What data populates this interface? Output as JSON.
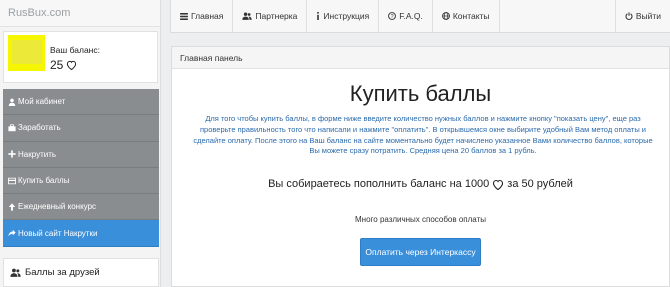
{
  "brand": "RusBux.com",
  "user": {
    "balance_label": "Ваш баланс:",
    "balance_value": "25"
  },
  "menu": [
    {
      "label": "Мой кабинет",
      "icon": "user-icon"
    },
    {
      "label": "Заработать",
      "icon": "briefcase-icon"
    },
    {
      "label": "Накрутить",
      "icon": "plus-icon"
    },
    {
      "label": "Купить баллы",
      "icon": "card-icon"
    },
    {
      "label": "Ежедневный конкурс",
      "icon": "up-arrow-icon"
    },
    {
      "label": "Новый сайт Накрутки",
      "icon": "share-icon",
      "active": true
    }
  ],
  "friends_label": "Баллы за друзей",
  "nav": {
    "home": "Главная",
    "partners": "Партнерка",
    "instruction": "Инструкция",
    "faq": "F.A.Q.",
    "contacts": "Контакты",
    "exit": "Выйти"
  },
  "panel": {
    "header": "Главная панель",
    "title": "Купить баллы",
    "description": "Для того чтобы купить баллы, в форме ниже введите количество нужных баллов и нажмите кнопку \"показать цену\", еще раз проверьте правильность того что написали и нажмите \"оплатить\". В открывшемся окне выбирите удобный Вам метод оплаты и сделайте оплату. После этого на Ваш баланс на сайте моментально будет начислено указанное Вами количество баллов, которые Вы можете сразу потратить. Средняя цена 20 баллов за 1 рубль.",
    "purchase_prefix": "Вы собираетесь пополнить баланс на 1000",
    "purchase_suffix": "за 50 рублей",
    "methods_text": "Много различных способов оплаты",
    "pay_button": "Оплатить через Интеркассу"
  },
  "colors": {
    "accent": "#3a8fdb",
    "menu_bg": "#8a8d90",
    "desc_text": "#2a6aad"
  }
}
